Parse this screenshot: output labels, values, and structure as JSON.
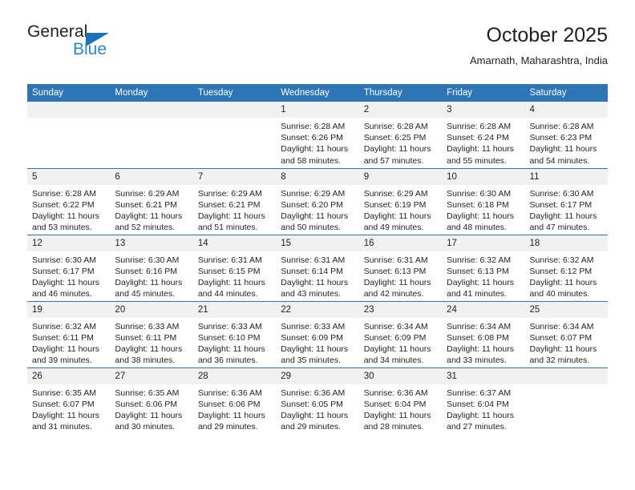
{
  "brand": {
    "name_part1": "General",
    "name_part2": "Blue",
    "accent_color": "#2b87d4",
    "triangle_color": "#1b72b8"
  },
  "header": {
    "title": "October 2025",
    "subtitle": "Amarnath, Maharashtra, India"
  },
  "calendar": {
    "header_bg": "#2e75b6",
    "daynum_bg": "#f1f1f1",
    "weekdays": [
      "Sunday",
      "Monday",
      "Tuesday",
      "Wednesday",
      "Thursday",
      "Friday",
      "Saturday"
    ],
    "weeks": [
      [
        {
          "day": "",
          "empty": true
        },
        {
          "day": "",
          "empty": true
        },
        {
          "day": "",
          "empty": true
        },
        {
          "day": "1",
          "sunrise": "Sunrise: 6:28 AM",
          "sunset": "Sunset: 6:26 PM",
          "daylight": "Daylight: 11 hours and 58 minutes."
        },
        {
          "day": "2",
          "sunrise": "Sunrise: 6:28 AM",
          "sunset": "Sunset: 6:25 PM",
          "daylight": "Daylight: 11 hours and 57 minutes."
        },
        {
          "day": "3",
          "sunrise": "Sunrise: 6:28 AM",
          "sunset": "Sunset: 6:24 PM",
          "daylight": "Daylight: 11 hours and 55 minutes."
        },
        {
          "day": "4",
          "sunrise": "Sunrise: 6:28 AM",
          "sunset": "Sunset: 6:23 PM",
          "daylight": "Daylight: 11 hours and 54 minutes."
        }
      ],
      [
        {
          "day": "5",
          "sunrise": "Sunrise: 6:28 AM",
          "sunset": "Sunset: 6:22 PM",
          "daylight": "Daylight: 11 hours and 53 minutes."
        },
        {
          "day": "6",
          "sunrise": "Sunrise: 6:29 AM",
          "sunset": "Sunset: 6:21 PM",
          "daylight": "Daylight: 11 hours and 52 minutes."
        },
        {
          "day": "7",
          "sunrise": "Sunrise: 6:29 AM",
          "sunset": "Sunset: 6:21 PM",
          "daylight": "Daylight: 11 hours and 51 minutes."
        },
        {
          "day": "8",
          "sunrise": "Sunrise: 6:29 AM",
          "sunset": "Sunset: 6:20 PM",
          "daylight": "Daylight: 11 hours and 50 minutes."
        },
        {
          "day": "9",
          "sunrise": "Sunrise: 6:29 AM",
          "sunset": "Sunset: 6:19 PM",
          "daylight": "Daylight: 11 hours and 49 minutes."
        },
        {
          "day": "10",
          "sunrise": "Sunrise: 6:30 AM",
          "sunset": "Sunset: 6:18 PM",
          "daylight": "Daylight: 11 hours and 48 minutes."
        },
        {
          "day": "11",
          "sunrise": "Sunrise: 6:30 AM",
          "sunset": "Sunset: 6:17 PM",
          "daylight": "Daylight: 11 hours and 47 minutes."
        }
      ],
      [
        {
          "day": "12",
          "sunrise": "Sunrise: 6:30 AM",
          "sunset": "Sunset: 6:17 PM",
          "daylight": "Daylight: 11 hours and 46 minutes."
        },
        {
          "day": "13",
          "sunrise": "Sunrise: 6:30 AM",
          "sunset": "Sunset: 6:16 PM",
          "daylight": "Daylight: 11 hours and 45 minutes."
        },
        {
          "day": "14",
          "sunrise": "Sunrise: 6:31 AM",
          "sunset": "Sunset: 6:15 PM",
          "daylight": "Daylight: 11 hours and 44 minutes."
        },
        {
          "day": "15",
          "sunrise": "Sunrise: 6:31 AM",
          "sunset": "Sunset: 6:14 PM",
          "daylight": "Daylight: 11 hours and 43 minutes."
        },
        {
          "day": "16",
          "sunrise": "Sunrise: 6:31 AM",
          "sunset": "Sunset: 6:13 PM",
          "daylight": "Daylight: 11 hours and 42 minutes."
        },
        {
          "day": "17",
          "sunrise": "Sunrise: 6:32 AM",
          "sunset": "Sunset: 6:13 PM",
          "daylight": "Daylight: 11 hours and 41 minutes."
        },
        {
          "day": "18",
          "sunrise": "Sunrise: 6:32 AM",
          "sunset": "Sunset: 6:12 PM",
          "daylight": "Daylight: 11 hours and 40 minutes."
        }
      ],
      [
        {
          "day": "19",
          "sunrise": "Sunrise: 6:32 AM",
          "sunset": "Sunset: 6:11 PM",
          "daylight": "Daylight: 11 hours and 39 minutes."
        },
        {
          "day": "20",
          "sunrise": "Sunrise: 6:33 AM",
          "sunset": "Sunset: 6:11 PM",
          "daylight": "Daylight: 11 hours and 38 minutes."
        },
        {
          "day": "21",
          "sunrise": "Sunrise: 6:33 AM",
          "sunset": "Sunset: 6:10 PM",
          "daylight": "Daylight: 11 hours and 36 minutes."
        },
        {
          "day": "22",
          "sunrise": "Sunrise: 6:33 AM",
          "sunset": "Sunset: 6:09 PM",
          "daylight": "Daylight: 11 hours and 35 minutes."
        },
        {
          "day": "23",
          "sunrise": "Sunrise: 6:34 AM",
          "sunset": "Sunset: 6:09 PM",
          "daylight": "Daylight: 11 hours and 34 minutes."
        },
        {
          "day": "24",
          "sunrise": "Sunrise: 6:34 AM",
          "sunset": "Sunset: 6:08 PM",
          "daylight": "Daylight: 11 hours and 33 minutes."
        },
        {
          "day": "25",
          "sunrise": "Sunrise: 6:34 AM",
          "sunset": "Sunset: 6:07 PM",
          "daylight": "Daylight: 11 hours and 32 minutes."
        }
      ],
      [
        {
          "day": "26",
          "sunrise": "Sunrise: 6:35 AM",
          "sunset": "Sunset: 6:07 PM",
          "daylight": "Daylight: 11 hours and 31 minutes."
        },
        {
          "day": "27",
          "sunrise": "Sunrise: 6:35 AM",
          "sunset": "Sunset: 6:06 PM",
          "daylight": "Daylight: 11 hours and 30 minutes."
        },
        {
          "day": "28",
          "sunrise": "Sunrise: 6:36 AM",
          "sunset": "Sunset: 6:06 PM",
          "daylight": "Daylight: 11 hours and 29 minutes."
        },
        {
          "day": "29",
          "sunrise": "Sunrise: 6:36 AM",
          "sunset": "Sunset: 6:05 PM",
          "daylight": "Daylight: 11 hours and 29 minutes."
        },
        {
          "day": "30",
          "sunrise": "Sunrise: 6:36 AM",
          "sunset": "Sunset: 6:04 PM",
          "daylight": "Daylight: 11 hours and 28 minutes."
        },
        {
          "day": "31",
          "sunrise": "Sunrise: 6:37 AM",
          "sunset": "Sunset: 6:04 PM",
          "daylight": "Daylight: 11 hours and 27 minutes."
        },
        {
          "day": "",
          "empty": true
        }
      ]
    ]
  }
}
